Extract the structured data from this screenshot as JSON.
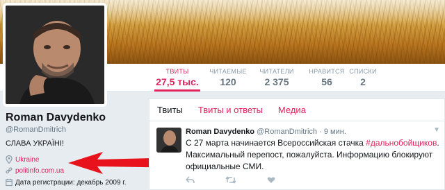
{
  "profile": {
    "name": "Roman Davydenko",
    "handle": "@RomanDmitrich",
    "bio": "СЛАВА УКРАЇНІ!",
    "location": "Ukraine",
    "url": "politinfo.com.ua",
    "joined": "Дата регистрации: декабрь 2009 г."
  },
  "stats": {
    "tweets": {
      "label": "ТВИТЫ",
      "value": "27,5 тыс."
    },
    "following": {
      "label": "ЧИТАЕМЫЕ",
      "value": "120"
    },
    "followers": {
      "label": "ЧИТАТЕЛИ",
      "value": "2 375"
    },
    "likes": {
      "label": "НРАВИТСЯ",
      "value": "56"
    },
    "lists": {
      "label": "СПИСКИ",
      "value": "2"
    }
  },
  "tabs": [
    {
      "label": "Твиты"
    },
    {
      "label": "Твиты и ответы"
    },
    {
      "label": "Медиа"
    }
  ],
  "tweet": {
    "name": "Roman Davydenko",
    "handle": "@RomanDmitrich",
    "separator": "·",
    "time": "9 мин.",
    "text_before": "С 27 марта начинается Всероссийская стачка ",
    "hashtag": "#дальнобойщиков",
    "text_after": ". Максимальный перепост, пожалуйста.  Информацию блокируют официальные СМИ."
  },
  "colors": {
    "accent": "#e0245e",
    "arrow": "#e8121c"
  },
  "icons": {
    "location": "map-pin-icon",
    "url": "link-icon",
    "joined": "calendar-icon",
    "reply": "reply-icon",
    "retweet": "retweet-icon",
    "like": "heart-icon",
    "more": "chevron-down-icon"
  }
}
